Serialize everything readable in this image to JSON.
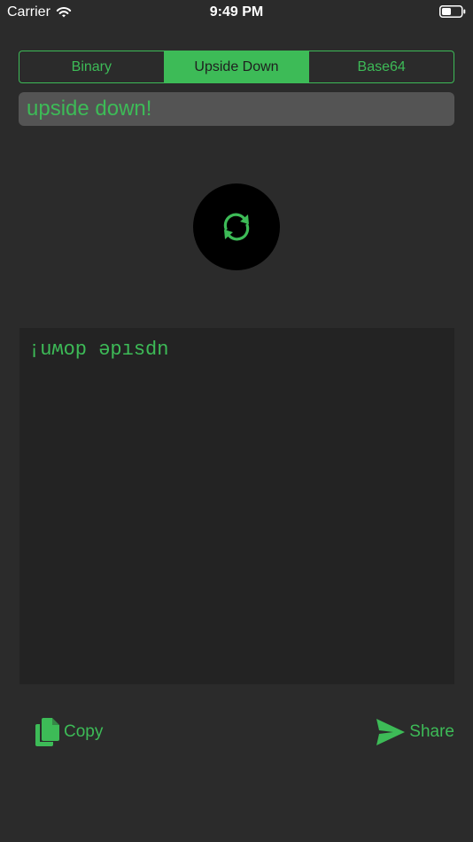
{
  "status_bar": {
    "carrier": "Carrier",
    "time": "9:49 PM"
  },
  "mode_selector": {
    "segments": [
      "Binary",
      "Upside Down",
      "Base64"
    ],
    "selected": "Upside Down"
  },
  "input": {
    "value": "upside down!"
  },
  "output": {
    "text": "¡uʍop ǝpısdn"
  },
  "actions": {
    "copy_label": "Copy",
    "share_label": "Share"
  },
  "colors": {
    "accent": "#3dbb57",
    "background": "#2b2b2b",
    "input_background": "#545454",
    "output_background": "#232323"
  },
  "icons": {
    "convert": "refresh-icon",
    "copy": "copy-icon",
    "share": "send-icon"
  }
}
